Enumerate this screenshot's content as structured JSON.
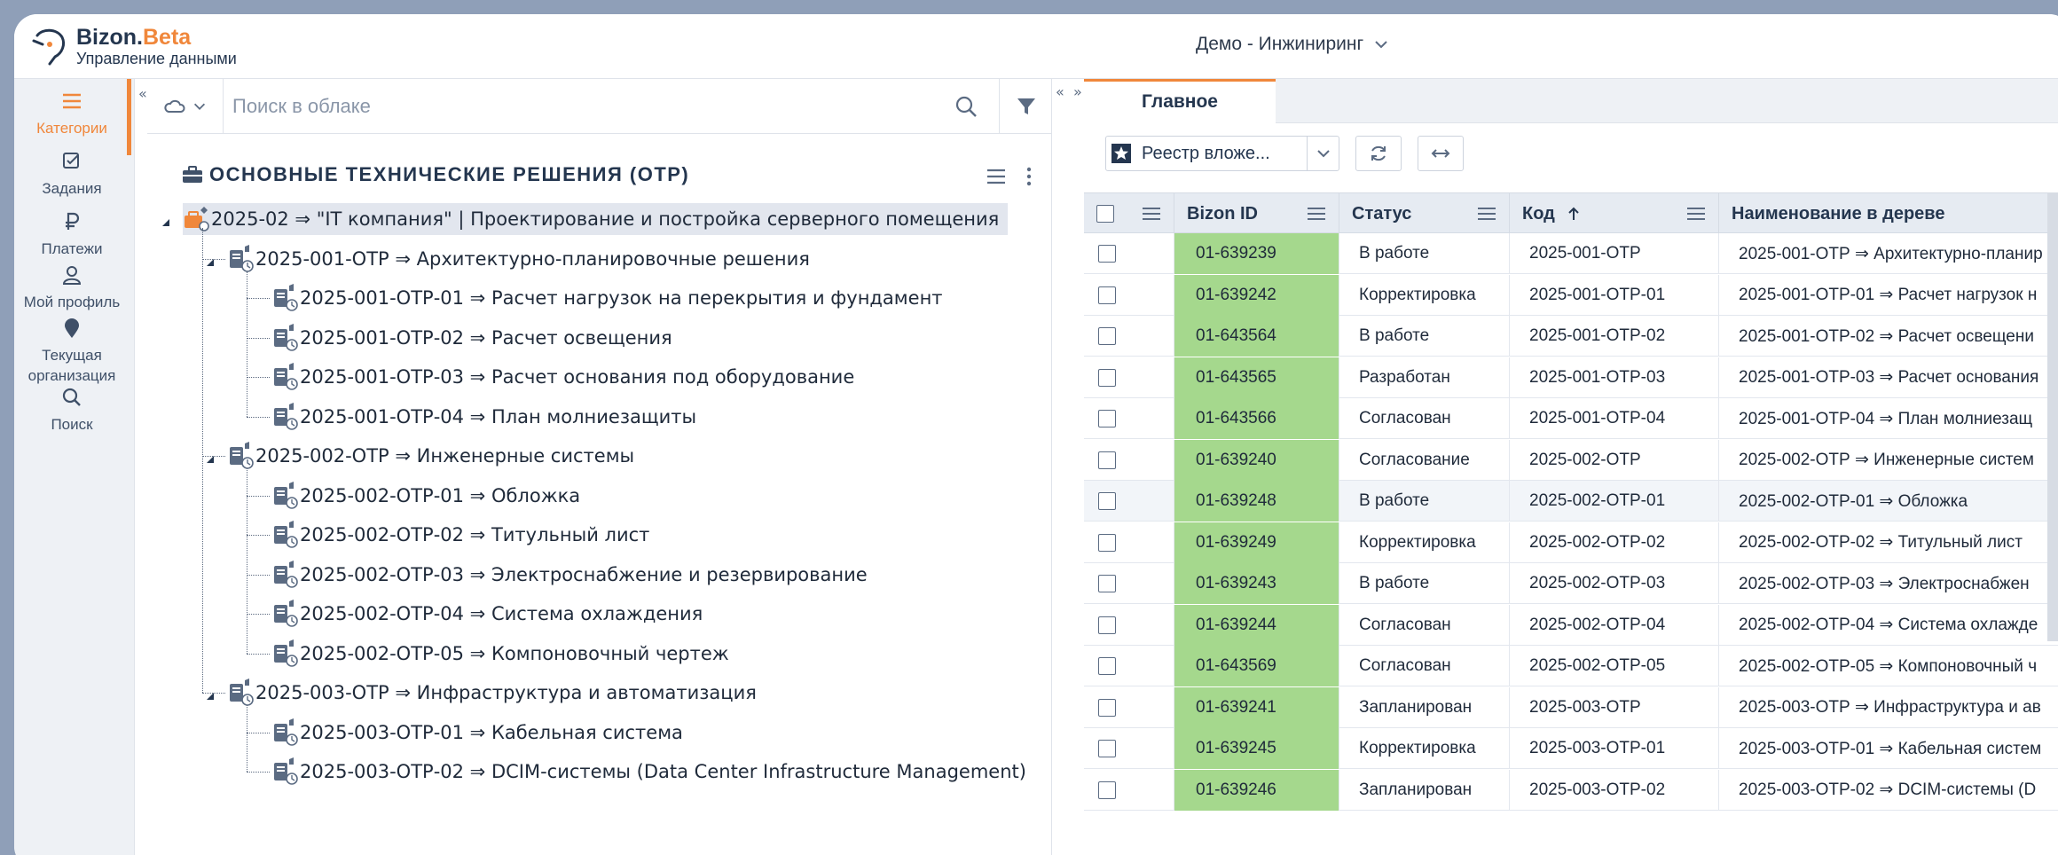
{
  "app": {
    "brand_main": "Bizon.",
    "brand_beta": "Beta",
    "brand_sub": "Управление данными",
    "workspace": "Демо - Инжиниринг"
  },
  "rail": [
    {
      "label": "Категории",
      "icon": "menu-icon",
      "active": true
    },
    {
      "label": "Задания",
      "icon": "checklist-icon"
    },
    {
      "label": "Платежи",
      "icon": "ruble-icon"
    },
    {
      "label": "Мой профиль",
      "icon": "user-icon"
    },
    {
      "label": "Текущая организация",
      "icon": "location-pin-icon"
    },
    {
      "label": "Поиск",
      "icon": "search-icon"
    }
  ],
  "search": {
    "placeholder": "Поиск в облаке"
  },
  "tree": {
    "title": "ОСНОВНЫЕ ТЕХНИЧЕСКИЕ РЕШЕНИЯ (ОТР)",
    "nodes": [
      {
        "label": "2025-02 ⇒ \"IT компания\" | Проектирование и постройка серверного помещения",
        "level": 0
      },
      {
        "label": "2025-001-ОТР ⇒ Архитектурно-планировочные решения",
        "level": 1
      },
      {
        "label": "2025-001-ОТР-01 ⇒ Расчет нагрузок на перекрытия и фундамент",
        "level": 2
      },
      {
        "label": "2025-001-ОТР-02 ⇒ Расчет освещения",
        "level": 2
      },
      {
        "label": "2025-001-ОТР-03 ⇒ Расчет основания под оборудование",
        "level": 2
      },
      {
        "label": "2025-001-ОТР-04 ⇒ План молниезащиты",
        "level": 2
      },
      {
        "label": "2025-002-ОТР ⇒ Инженерные системы",
        "level": 1
      },
      {
        "label": "2025-002-ОТР-01 ⇒ Обложка",
        "level": 2
      },
      {
        "label": "2025-002-ОТР-02 ⇒ Титульный лист",
        "level": 2
      },
      {
        "label": "2025-002-ОТР-03 ⇒ Электроснабжение и резервирование",
        "level": 2
      },
      {
        "label": "2025-002-ОТР-04 ⇒ Система охлаждения",
        "level": 2
      },
      {
        "label": "2025-002-ОТР-05 ⇒ Компоновочный чертеж",
        "level": 2
      },
      {
        "label": "2025-003-ОТР ⇒ Инфраструктура и автоматизация",
        "level": 1
      },
      {
        "label": "2025-003-ОТР-01 ⇒ Кабельная система",
        "level": 2
      },
      {
        "label": "2025-003-ОТР-02 ⇒ DCIM-системы (Data Center Infrastructure Management)",
        "level": 2
      }
    ]
  },
  "right": {
    "tab": "Главное",
    "registry": "Реестр вложе...",
    "columns": [
      "Bizon ID",
      "Статус",
      "Код",
      "Наименование в дереве"
    ],
    "rows": [
      [
        "01-639239",
        "В работе",
        "2025-001-ОТР",
        "2025-001-ОТР ⇒ Архитектурно-планир"
      ],
      [
        "01-639242",
        "Корректировка",
        "2025-001-ОТР-01",
        "2025-001-ОТР-01 ⇒ Расчет нагрузок н"
      ],
      [
        "01-643564",
        "В работе",
        "2025-001-ОТР-02",
        "2025-001-ОТР-02 ⇒ Расчет освещени"
      ],
      [
        "01-643565",
        "Разработан",
        "2025-001-ОТР-03",
        "2025-001-ОТР-03 ⇒ Расчет основания"
      ],
      [
        "01-643566",
        "Согласован",
        "2025-001-ОТР-04",
        "2025-001-ОТР-04 ⇒ План молниезащ"
      ],
      [
        "01-639240",
        "Согласование",
        "2025-002-ОТР",
        "2025-002-ОТР ⇒ Инженерные систем"
      ],
      [
        "01-639248",
        "В работе",
        "2025-002-ОТР-01",
        "2025-002-ОТР-01 ⇒ Обложка"
      ],
      [
        "01-639249",
        "Корректировка",
        "2025-002-ОТР-02",
        "2025-002-ОТР-02 ⇒ Титульный лист"
      ],
      [
        "01-639243",
        "В работе",
        "2025-002-ОТР-03",
        "2025-002-ОТР-03 ⇒ Электроснабжен"
      ],
      [
        "01-639244",
        "Согласован",
        "2025-002-ОТР-04",
        "2025-002-ОТР-04 ⇒ Система охлажде"
      ],
      [
        "01-643569",
        "Согласован",
        "2025-002-ОТР-05",
        "2025-002-ОТР-05 ⇒ Компоновочный ч"
      ],
      [
        "01-639241",
        "Запланирован",
        "2025-003-ОТР",
        "2025-003-ОТР ⇒ Инфраструктура и ав"
      ],
      [
        "01-639245",
        "Корректировка",
        "2025-003-ОТР-01",
        "2025-003-ОТР-01 ⇒ Кабельная систем"
      ],
      [
        "01-639246",
        "Запланирован",
        "2025-003-ОТР-02",
        "2025-003-ОТР-02 ⇒ DCIM-системы (D"
      ]
    ]
  },
  "colors": {
    "accent": "#f0873b",
    "id_cell": "#a5d88d",
    "text": "#24364f"
  }
}
